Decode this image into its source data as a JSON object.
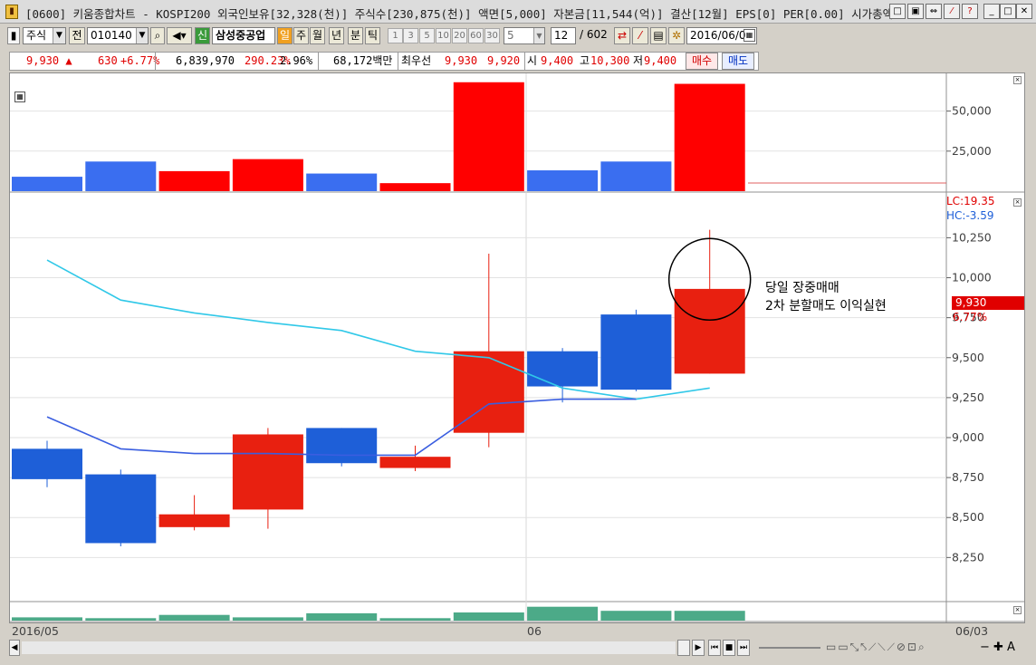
{
  "window": {
    "title": "[0600] 키움종합차트 - KOSPI200 외국인보유[32,328(천)] 주식수[230,875(천)] 액면[5,000] 자본금[11,544(억)] 결산[12월] EPS[0] PER[0.00] 시가총액",
    "buttons": [
      "□",
      "▣",
      "⇔",
      "⁄",
      "?",
      "_",
      "□",
      "✕"
    ]
  },
  "toolbar": {
    "market": "주식",
    "prev_label": "전",
    "code": "010140",
    "new_label": "신",
    "stock_name": "삼성중공업",
    "periods": [
      "일",
      "주",
      "월",
      "년",
      "분",
      "틱"
    ],
    "intervals": [
      "1",
      "3",
      "5",
      "10",
      "20",
      "60",
      "30",
      "5"
    ],
    "count": "12",
    "total": "/ 602",
    "date": "2016/06/0"
  },
  "quote": {
    "price": "9,930 ▲",
    "change": "630",
    "change_pct": "+6.77%",
    "volume": "6,839,970",
    "volume_pct": "290.23%",
    "turnover": "2.96%",
    "amount": "68,172백만",
    "best_label": "최우선",
    "best_ask": "9,930",
    "best_bid": "9,920",
    "open_label": "시",
    "open": "9,400",
    "high_label": "고",
    "high": "10,300",
    "low_label": "저",
    "low": "9,400",
    "buy_label": "매수",
    "sell_label": "매도"
  },
  "chart_data": [
    {
      "type": "bar",
      "pane": "volume-top",
      "categories": [
        "1",
        "2",
        "3",
        "4",
        "5",
        "6",
        "7",
        "8",
        "9",
        "10"
      ],
      "values": [
        9000,
        18500,
        12500,
        20000,
        11000,
        5000,
        68000,
        13000,
        18500,
        67000
      ],
      "colors": [
        "#3a6ef0",
        "#3a6ef0",
        "#ff0000",
        "#ff0000",
        "#3a6ef0",
        "#ff0000",
        "#ff0000",
        "#3a6ef0",
        "#3a6ef0",
        "#ff0000"
      ],
      "ylim": [
        0,
        69000
      ],
      "yticks": [
        "50,000",
        "25,000"
      ],
      "ytick_values": [
        50000,
        25000
      ]
    },
    {
      "type": "candlestick",
      "pane": "price",
      "categories": [
        "1",
        "2",
        "3",
        "4",
        "5",
        "6",
        "7",
        "8",
        "9",
        "10"
      ],
      "candles": [
        {
          "o": 8930,
          "h": 8980,
          "l": 8690,
          "c": 8740,
          "up": false
        },
        {
          "o": 8770,
          "h": 8800,
          "l": 8320,
          "c": 8340,
          "up": false
        },
        {
          "o": 8440,
          "h": 8640,
          "l": 8420,
          "c": 8520,
          "up": true
        },
        {
          "o": 8550,
          "h": 9060,
          "l": 8430,
          "c": 9020,
          "up": true
        },
        {
          "o": 9060,
          "h": 9060,
          "l": 8820,
          "c": 8840,
          "up": false
        },
        {
          "o": 8810,
          "h": 8950,
          "l": 8790,
          "c": 8880,
          "up": true
        },
        {
          "o": 9030,
          "h": 10150,
          "l": 8940,
          "c": 9540,
          "up": true
        },
        {
          "o": 9540,
          "h": 9560,
          "l": 9220,
          "c": 9320,
          "up": false
        },
        {
          "o": 9770,
          "h": 9800,
          "l": 9290,
          "c": 9300,
          "up": false
        },
        {
          "o": 9400,
          "h": 10300,
          "l": 9400,
          "c": 9930,
          "up": true
        }
      ],
      "ma_long": [
        10110,
        9860,
        9780,
        9720,
        9670,
        9540,
        9500,
        9310,
        9240,
        9310
      ],
      "ma_short": [
        9130,
        8930,
        8900,
        8900,
        8890,
        8890,
        9210,
        9240,
        9240,
        null
      ],
      "ylim": [
        7980,
        10530
      ],
      "yticks": [
        "10,250",
        "10,000",
        "9,750",
        "9,500",
        "9,250",
        "9,000",
        "8,750",
        "8,500",
        "8,250"
      ],
      "ytick_values": [
        10250,
        10000,
        9750,
        9500,
        9250,
        9000,
        8750,
        8500,
        8250
      ],
      "current_price_label": "9,930",
      "current_pct_label": "6.77%",
      "lc_label": "LC:19.35",
      "hc_label": "HC:-3.59",
      "annotation_line1": "당일 장중매매",
      "annotation_line2": "2차 분할매도 이익실현"
    },
    {
      "type": "bar",
      "pane": "volume-bottom",
      "categories": [
        "1",
        "2",
        "3",
        "4",
        "5",
        "6",
        "7",
        "8",
        "9",
        "10"
      ],
      "values": [
        4,
        3,
        7,
        4,
        9,
        3,
        10,
        17,
        12,
        12
      ],
      "ylim": [
        0,
        20
      ]
    }
  ],
  "xaxis": {
    "labels": [
      "2016/05",
      "06",
      "06/03"
    ]
  },
  "colors": {
    "up": "#e82010",
    "down": "#1e5fd8",
    "ma_long": "#30c8e8",
    "ma_short": "#3a5ee0",
    "vol_green": "#4caa88"
  }
}
